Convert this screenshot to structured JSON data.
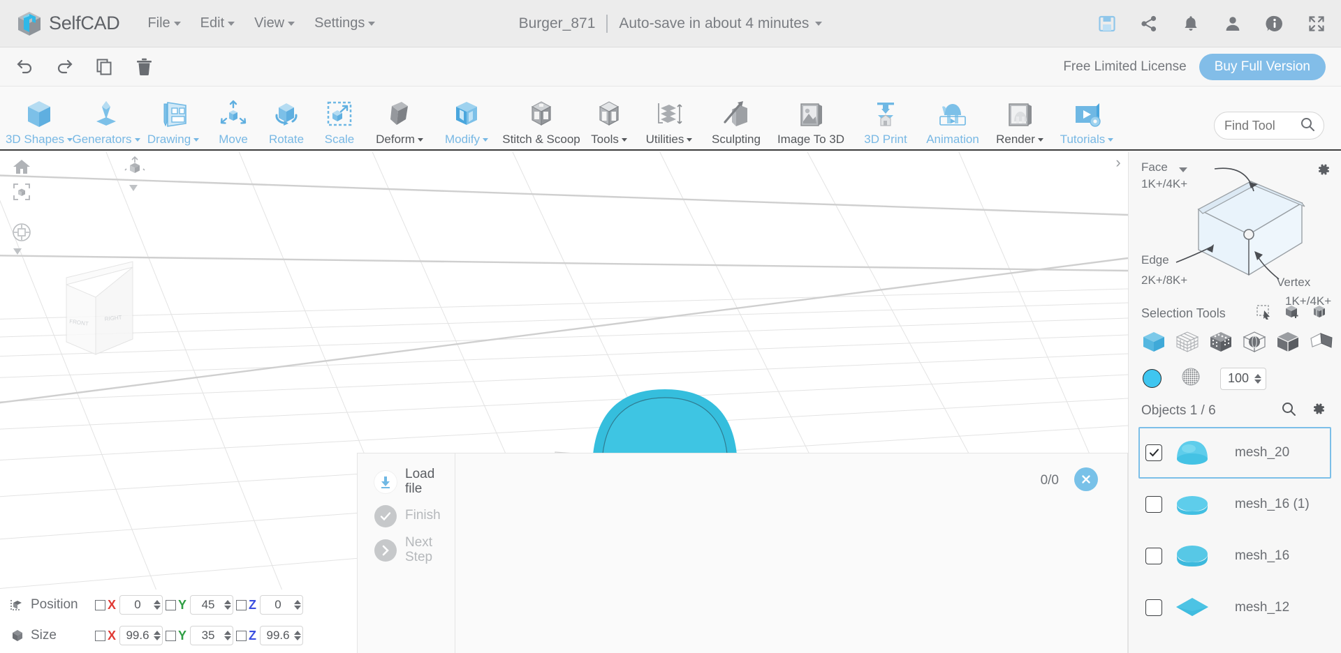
{
  "header": {
    "brand": "SelfCAD",
    "menus": [
      {
        "label": "File",
        "caret": true
      },
      {
        "label": "Edit",
        "caret": true
      },
      {
        "label": "View",
        "caret": true
      },
      {
        "label": "Settings",
        "caret": true
      }
    ],
    "document_title": "Burger_871",
    "autosave_text": "Auto-save in about 4 minutes",
    "icons": [
      {
        "name": "save-icon",
        "title": "Save"
      },
      {
        "name": "share-icon",
        "title": "Share"
      },
      {
        "name": "notifications-bell-icon",
        "title": "Notifications"
      },
      {
        "name": "user-account-icon",
        "title": "Account"
      },
      {
        "name": "info-icon",
        "title": "Info"
      },
      {
        "name": "fullscreen-icon",
        "title": "Fullscreen"
      }
    ],
    "accent_color": "#82bde8",
    "save_icon_color": "#82bde8"
  },
  "secondbar": {
    "history": [
      {
        "name": "undo-button",
        "label": "Undo"
      },
      {
        "name": "redo-button",
        "label": "Redo"
      },
      {
        "name": "copy-button",
        "label": "Copy"
      },
      {
        "name": "delete-button",
        "label": "Delete"
      }
    ],
    "license_text": "Free Limited License",
    "buy_label": "Buy Full Version"
  },
  "ribbon": {
    "tools": [
      {
        "label": "3D Shapes",
        "caret": true,
        "enabled": true,
        "icon": "cube-blue-icon"
      },
      {
        "label": "Generators",
        "caret": true,
        "enabled": true,
        "icon": "lathe-blue-icon"
      },
      {
        "label": "Drawing",
        "caret": true,
        "enabled": true,
        "icon": "pencil-sketch-blue-icon"
      },
      {
        "label": "Move",
        "caret": false,
        "enabled": true,
        "icon": "move-arrows-icon"
      },
      {
        "label": "Rotate",
        "caret": false,
        "enabled": true,
        "icon": "rotate-cube-icon"
      },
      {
        "label": "Scale",
        "caret": false,
        "enabled": true,
        "icon": "scale-cube-icon"
      },
      {
        "label": "Deform",
        "caret": true,
        "enabled": false,
        "icon": "deform-gray-icon"
      },
      {
        "label": "Modify",
        "caret": true,
        "enabled": true,
        "icon": "modify-blue-icon"
      },
      {
        "label": "Stitch & Scoop",
        "caret": false,
        "enabled": false,
        "icon": "stitch-scoop-icon"
      },
      {
        "label": "Tools",
        "caret": true,
        "enabled": false,
        "icon": "tools-cube-icon"
      },
      {
        "label": "Utilities",
        "caret": true,
        "enabled": false,
        "icon": "utilities-layers-icon"
      },
      {
        "label": "Sculpting",
        "caret": false,
        "enabled": false,
        "icon": "sculpting-chisel-icon"
      },
      {
        "label": "Image To 3D",
        "caret": false,
        "enabled": false,
        "icon": "image-to-3d-icon"
      },
      {
        "label": "3D Print",
        "caret": false,
        "enabled": true,
        "icon": "3d-printer-icon"
      },
      {
        "label": "Animation",
        "caret": false,
        "enabled": true,
        "icon": "animation-film-icon"
      },
      {
        "label": "Render",
        "caret": true,
        "enabled": false,
        "icon": "render-frame-icon"
      },
      {
        "label": "Tutorials",
        "caret": true,
        "enabled": true,
        "icon": "tutorials-play-icon"
      }
    ],
    "find_tool_placeholder": "Find Tool"
  },
  "viewport": {
    "controls": [
      {
        "name": "home-view-button"
      },
      {
        "name": "fit-to-view-button"
      },
      {
        "name": "orbit-pivot-button"
      },
      {
        "name": "view-cube-axis-button"
      }
    ],
    "viewcube_faces": [
      "FRONT",
      "RIGHT"
    ],
    "axis_labels": {
      "x": "X",
      "y": "Y",
      "z": "Z"
    },
    "axis_colors": {
      "x": "#e03a34",
      "y": "#2f9e44",
      "z": "#3b4fe0"
    },
    "model_color": "#3fc0e0",
    "expander_glyph": "›"
  },
  "wizard": {
    "steps": [
      {
        "label": "Load file",
        "state": "active",
        "icon": "download-icon"
      },
      {
        "label": "Finish",
        "state": "disabled",
        "icon": "check-icon"
      },
      {
        "label": "Next Step",
        "state": "disabled",
        "icon": "chevron-right-icon"
      }
    ],
    "count": "0/0",
    "close_label": "×"
  },
  "transform": {
    "rows": [
      {
        "name": "position",
        "label": "Position",
        "icon": "position-gizmo-icon",
        "axes": [
          {
            "axis": "X",
            "checked": false,
            "value": "0"
          },
          {
            "axis": "Y",
            "checked": false,
            "value": "45"
          },
          {
            "axis": "Z",
            "checked": false,
            "value": "0"
          }
        ]
      },
      {
        "name": "size",
        "label": "Size",
        "icon": "size-cube-icon",
        "axes": [
          {
            "axis": "X",
            "checked": false,
            "value": "99.6"
          },
          {
            "axis": "Y",
            "checked": false,
            "value": "35"
          },
          {
            "axis": "Z",
            "checked": false,
            "value": "99.6"
          }
        ]
      }
    ]
  },
  "right_panel": {
    "selection_mode": "Face",
    "diagram": {
      "face_label": "Face",
      "face_count": "1K+/4K+",
      "edge_label": "Edge",
      "edge_count": "2K+/8K+",
      "vertex_label": "Vertex",
      "vertex_count": "1K+/4K+"
    },
    "selection_tools_label": "Selection Tools",
    "selection_tool_icons": [
      {
        "name": "rectangle-select-icon"
      },
      {
        "name": "add-to-selection-icon"
      },
      {
        "name": "grouped-selection-icon"
      }
    ],
    "mode_icons": [
      {
        "name": "object-mode-icon",
        "active": true
      },
      {
        "name": "wireframe-mode-icon",
        "active": false
      },
      {
        "name": "polygon-mode-icon",
        "active": false
      },
      {
        "name": "sphere-in-cube-mode-icon",
        "active": false
      },
      {
        "name": "half-cube-mode-icon",
        "active": false
      },
      {
        "name": "flat-face-mode-icon",
        "active": false
      }
    ],
    "color_swatch": "#3fc6f0",
    "texture_icon": "texture-sphere-icon",
    "opacity_value": "100",
    "objects_label": "Objects 1 / 6",
    "objects_header_icons": [
      {
        "name": "search-objects-icon"
      },
      {
        "name": "objects-settings-gear-icon"
      }
    ],
    "objects": [
      {
        "name": "mesh_20",
        "checked": true,
        "selected": true,
        "shape": "dome"
      },
      {
        "name": "mesh_16 (1)",
        "checked": false,
        "selected": false,
        "shape": "disc-flat"
      },
      {
        "name": "mesh_16",
        "checked": false,
        "selected": false,
        "shape": "disc"
      },
      {
        "name": "mesh_12",
        "checked": false,
        "selected": false,
        "shape": "diamond"
      }
    ]
  }
}
